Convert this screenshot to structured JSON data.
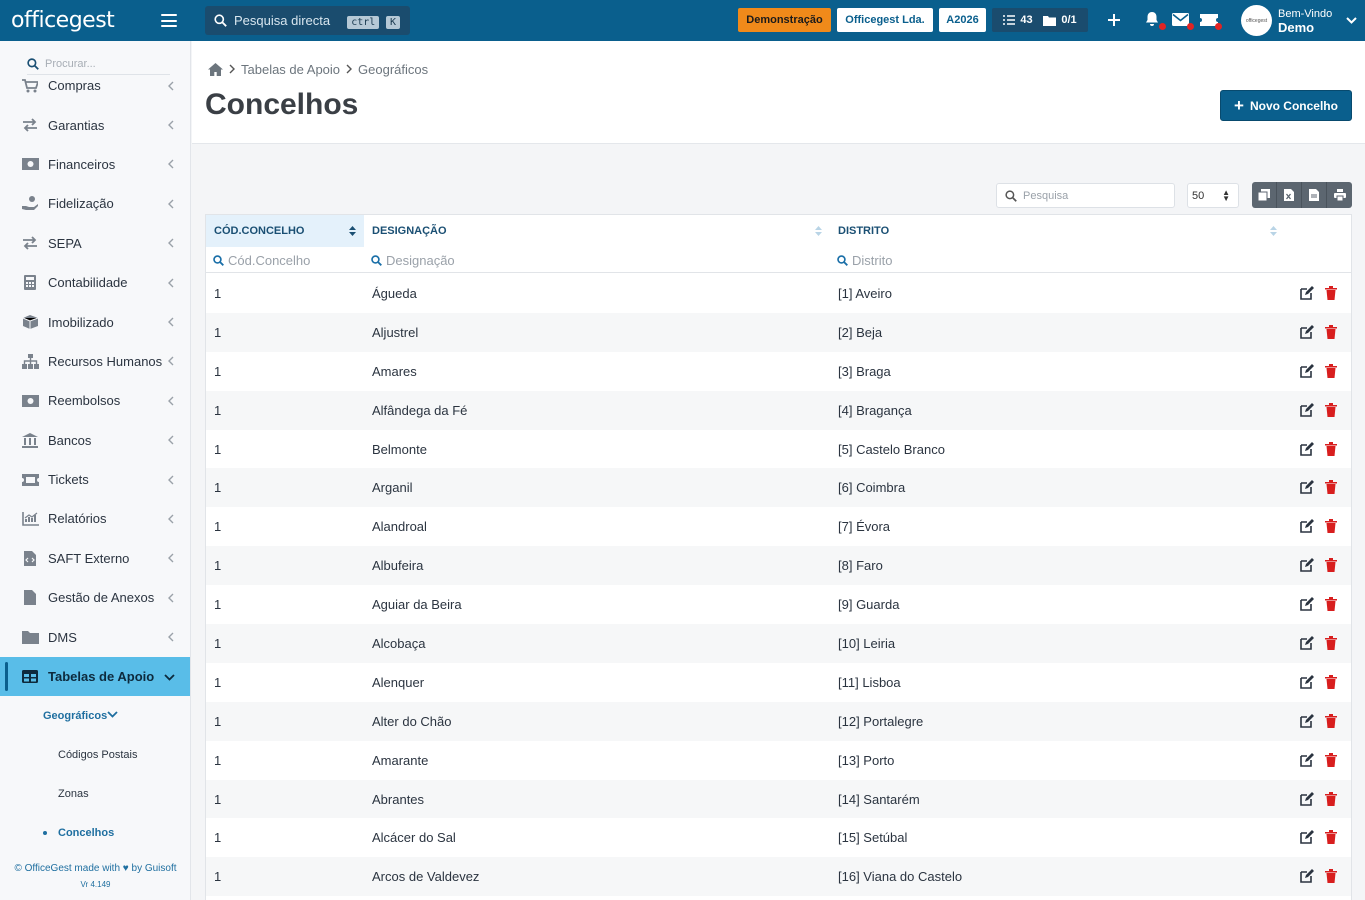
{
  "topbar": {
    "logo": "officegest",
    "search_placeholder": "Pesquisa directa",
    "kbd1": "ctrl",
    "kbd2": "K",
    "demo_badge": "Demonstração",
    "company": "Officegest Lda.",
    "year": "A2026",
    "tasks_count": "43",
    "docs_count": "0/1",
    "welcome": "Bem-Vindo",
    "user_name": "Demo",
    "avatar_text": "officegest",
    "colors": {
      "bar": "#0a5f8d",
      "demo": "#f08a1a",
      "alert": "#e02424"
    }
  },
  "sidebar": {
    "search_placeholder": "Procurar...",
    "items": [
      {
        "label": "Compras",
        "icon": "cart-icon"
      },
      {
        "label": "Garantias",
        "icon": "exchange-icon"
      },
      {
        "label": "Financeiros",
        "icon": "money-icon"
      },
      {
        "label": "Fidelização",
        "icon": "hand-coin-icon"
      },
      {
        "label": "SEPA",
        "icon": "exchange-icon"
      },
      {
        "label": "Contabilidade",
        "icon": "calculator-icon"
      },
      {
        "label": "Imobilizado",
        "icon": "boxes-icon"
      },
      {
        "label": "Recursos Humanos",
        "icon": "org-chart-icon"
      },
      {
        "label": "Reembolsos",
        "icon": "money-icon"
      },
      {
        "label": "Bancos",
        "icon": "bank-icon"
      },
      {
        "label": "Tickets",
        "icon": "ticket-icon"
      },
      {
        "label": "Relatórios",
        "icon": "chart-icon"
      },
      {
        "label": "SAFT Externo",
        "icon": "file-code-icon"
      },
      {
        "label": "Gestão de Anexos",
        "icon": "file-icon"
      },
      {
        "label": "DMS",
        "icon": "folder-icon"
      },
      {
        "label": "Tabelas de Apoio",
        "icon": "table-icon"
      }
    ],
    "sub_group": "Geográficos",
    "sub_items": [
      "Códigos Postais",
      "Zonas",
      "Concelhos"
    ],
    "footer": "© OfficeGest made with ♥ by Guisoft",
    "version": "Vr 4.149"
  },
  "breadcrumb": [
    "Tabelas de Apoio",
    "Geográficos"
  ],
  "page_title": "Concelhos",
  "new_button": "Novo Concelho",
  "toolbar": {
    "search_placeholder": "Pesquisa",
    "page_size": "50"
  },
  "table": {
    "headers": [
      "CÓD.CONCELHO",
      "DESIGNAÇÃO",
      "DISTRITO"
    ],
    "filters": [
      "Cód.Concelho",
      "Designação",
      "Distrito"
    ],
    "rows": [
      {
        "code": "1",
        "name": "Águeda",
        "district": "[1] Aveiro"
      },
      {
        "code": "1",
        "name": "Aljustrel",
        "district": "[2] Beja"
      },
      {
        "code": "1",
        "name": "Amares",
        "district": "[3] Braga"
      },
      {
        "code": "1",
        "name": "Alfândega da Fé",
        "district": "[4] Bragança"
      },
      {
        "code": "1",
        "name": "Belmonte",
        "district": "[5] Castelo Branco"
      },
      {
        "code": "1",
        "name": "Arganil",
        "district": "[6] Coimbra"
      },
      {
        "code": "1",
        "name": "Alandroal",
        "district": "[7] Évora"
      },
      {
        "code": "1",
        "name": "Albufeira",
        "district": "[8] Faro"
      },
      {
        "code": "1",
        "name": "Aguiar da Beira",
        "district": "[9] Guarda"
      },
      {
        "code": "1",
        "name": "Alcobaça",
        "district": "[10] Leiria"
      },
      {
        "code": "1",
        "name": "Alenquer",
        "district": "[11] Lisboa"
      },
      {
        "code": "1",
        "name": "Alter do Chão",
        "district": "[12] Portalegre"
      },
      {
        "code": "1",
        "name": "Amarante",
        "district": "[13] Porto"
      },
      {
        "code": "1",
        "name": "Abrantes",
        "district": "[14] Santarém"
      },
      {
        "code": "1",
        "name": "Alcácer do Sal",
        "district": "[15] Setúbal"
      },
      {
        "code": "1",
        "name": "Arcos de Valdevez",
        "district": "[16] Viana do Castelo"
      }
    ]
  }
}
